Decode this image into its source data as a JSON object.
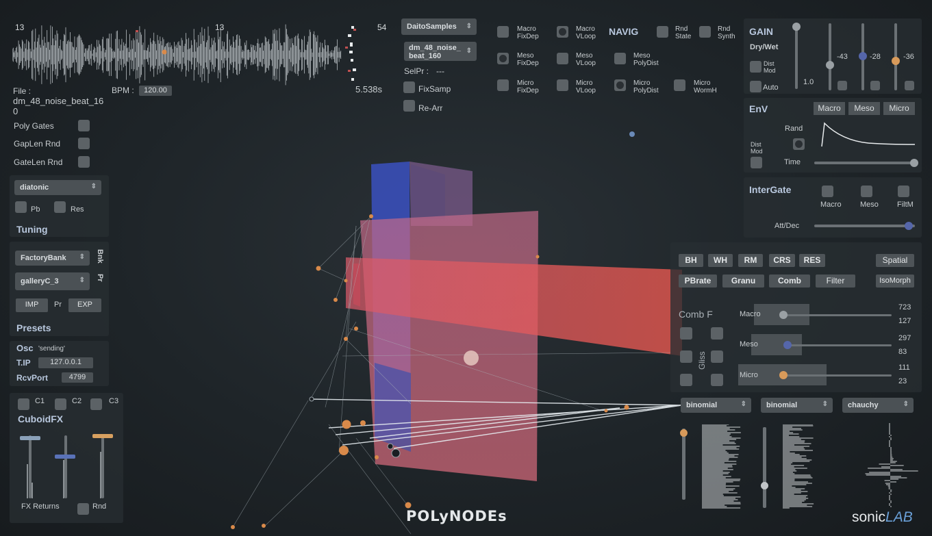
{
  "waveform": {
    "markers": [
      "13",
      "13",
      "54"
    ],
    "file_label": "File :",
    "file_name": "dm_48_noise_beat_16",
    "file_name_cont": "0",
    "bpm_label": "BPM :",
    "bpm_value": "120.00",
    "duration": "5.538s"
  },
  "gates": {
    "poly_gates": "Poly Gates",
    "gaplen_rnd": "GapLen Rnd",
    "gatelen_rnd": "GateLen Rnd"
  },
  "tuning": {
    "scale": "diatonic",
    "pb": "Pb",
    "res": "Res",
    "title": "Tuning"
  },
  "presets": {
    "bank": "FactoryBank",
    "preset": "galleryC_3",
    "bnk": "Bnk",
    "pr_side": "Pr",
    "imp": "IMP",
    "pr": "Pr",
    "exp": "EXP",
    "title": "Presets"
  },
  "osc": {
    "title": "Osc",
    "status": "'sending'",
    "tip_label": "T.IP",
    "tip_value": "127.0.0.1",
    "rcv_label": "RcvPort",
    "rcv_value": "4799"
  },
  "cuboid": {
    "c1": "C1",
    "c2": "C2",
    "c3": "C3",
    "title": "CuboidFX",
    "fx_returns": "FX Returns",
    "rnd": "Rnd"
  },
  "sampler": {
    "source": "DaitoSamples",
    "sample": "dm_48_noise_",
    "sample_cont": "beat_160",
    "selpr_label": "SelPr :",
    "selpr_value": "---",
    "fixsamp": "FixSamp",
    "rearr": "Re-Arr"
  },
  "navig": {
    "title": "NAVIG",
    "macro_fixdep": [
      "Macro",
      "FixDep"
    ],
    "macro_vloop": [
      "Macro",
      "VLoop"
    ],
    "meso_fixdep": [
      "Meso",
      "FixDep"
    ],
    "meso_vloop": [
      "Meso",
      "VLoop"
    ],
    "meso_polydist": [
      "Meso",
      "PolyDist"
    ],
    "micro_fixdep": [
      "Micro",
      "FixDep"
    ],
    "micro_vloop": [
      "Micro",
      "VLoop"
    ],
    "micro_polydist": [
      "Micro",
      "PolyDist"
    ],
    "micro_wormh": [
      "Micro",
      "WormH"
    ],
    "rnd_state": [
      "Rnd",
      "State"
    ],
    "rnd_synth": [
      "Rnd",
      "Synth"
    ]
  },
  "gain": {
    "title": "GAIN",
    "drywet": "Dry/Wet",
    "dist_mod": [
      "Dist",
      "Mod"
    ],
    "auto": "Auto",
    "value_main": "1.0",
    "values": [
      "-43",
      "-28",
      "-36"
    ],
    "colors": {
      "slider1": "#9aa0a4",
      "slider2": "#5566aa",
      "slider3": "#d89a5a"
    }
  },
  "env": {
    "title": "EnV",
    "tabs": [
      "Macro",
      "Meso",
      "Micro"
    ],
    "rand": "Rand",
    "dist_mod": [
      "Dist",
      "Mod"
    ],
    "time": "Time"
  },
  "intergate": {
    "title": "InterGate",
    "options": [
      "Macro",
      "Meso",
      "FiltM"
    ],
    "attdec": "Att/Dec"
  },
  "fx": {
    "row1": [
      "BH",
      "WH",
      "RM",
      "CRS",
      "RES"
    ],
    "spatial": "Spatial",
    "row2": [
      "PBrate",
      "Granu",
      "Comb",
      "Filter"
    ],
    "isomorph": "IsoMorph",
    "comb_f": "Comb F",
    "gliss": "Gliss",
    "bands": [
      {
        "name": "Macro",
        "hi": "723",
        "lo": "127"
      },
      {
        "name": "Meso",
        "hi": "297",
        "lo": "83"
      },
      {
        "name": "Micro",
        "hi": "111",
        "lo": "23"
      }
    ]
  },
  "distributions": [
    "binomial",
    "binomial",
    "chauchy"
  ],
  "app_title": "POLyNODEs",
  "brand": {
    "sonic": "sonic",
    "lab": "LAB"
  },
  "colors": {
    "panel": "#2c3236",
    "accent_blue": "#b9c8de",
    "orange": "#d98a4a",
    "red_plane": "#e0575a",
    "blue_plane": "#3d55b8"
  }
}
